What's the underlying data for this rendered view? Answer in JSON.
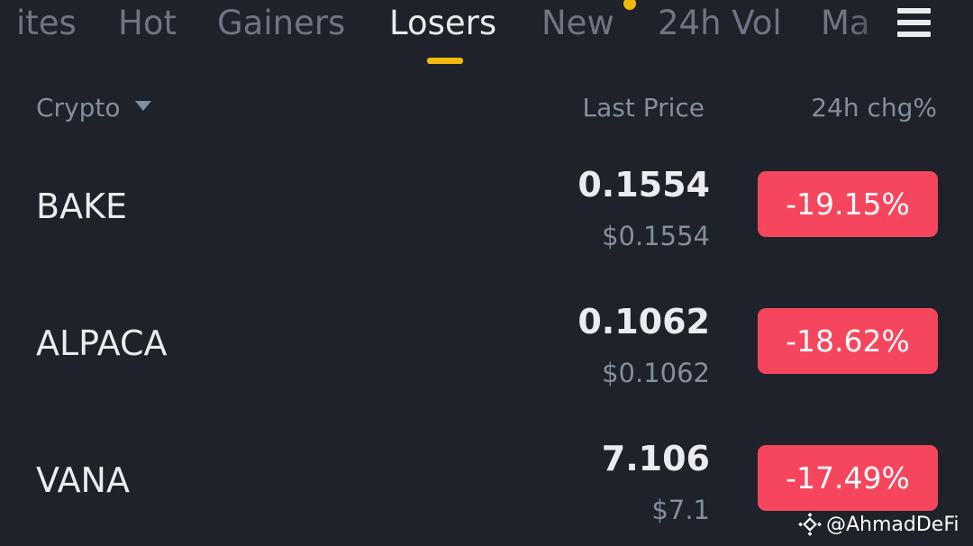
{
  "tabs": [
    {
      "label": "ites"
    },
    {
      "label": "Hot"
    },
    {
      "label": "Gainers"
    },
    {
      "label": "Losers",
      "active": true
    },
    {
      "label": "New",
      "has_dot": true
    },
    {
      "label": "24h Vol"
    },
    {
      "label": "Ma"
    }
  ],
  "menu_icon": "hamburger-menu-icon",
  "columns": {
    "crypto": "Crypto",
    "last_price": "Last Price",
    "change": "24h chg%"
  },
  "rows": [
    {
      "symbol": "BAKE",
      "price": "0.1554",
      "usd": "$0.1554",
      "change": "-19.15%"
    },
    {
      "symbol": "ALPACA",
      "price": "0.1062",
      "usd": "$0.1062",
      "change": "-18.62%"
    },
    {
      "symbol": "VANA",
      "price": "7.106",
      "usd": "$7.1",
      "change": "-17.49%"
    }
  ],
  "watermark": {
    "text": "@AhmadDeFi",
    "icon": "binance-logo-icon"
  },
  "colors": {
    "background": "#1f222b",
    "accent": "#f0b90b",
    "negative": "#f6465d",
    "text_primary": "#eaecef",
    "text_secondary": "#848e9c"
  }
}
